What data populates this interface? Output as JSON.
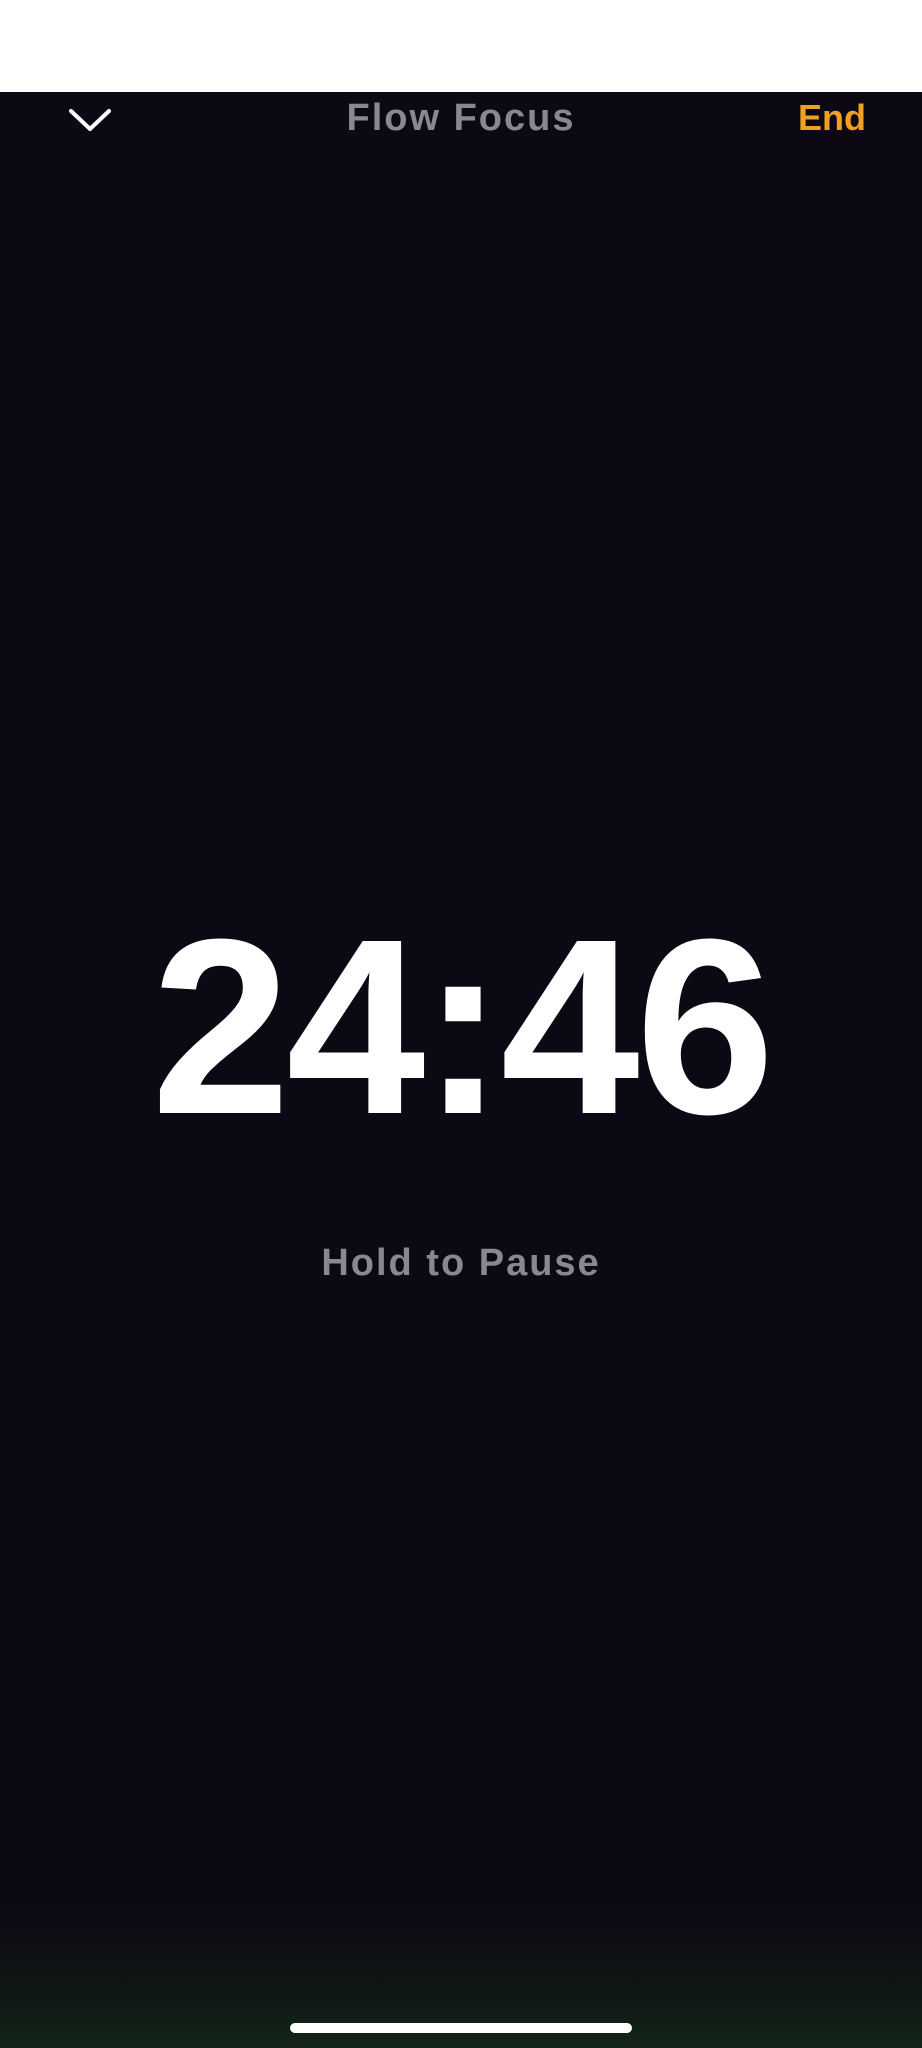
{
  "header": {
    "collapse_icon": "chevron-down-icon",
    "title": "Flow Focus",
    "end_label": "End"
  },
  "timer": {
    "time": "24:46",
    "hint": "Hold to Pause"
  },
  "colors": {
    "background": "#0d0914",
    "accent": "#f0a020",
    "muted_text": "#8a8794",
    "timer_text": "#ffffff"
  }
}
